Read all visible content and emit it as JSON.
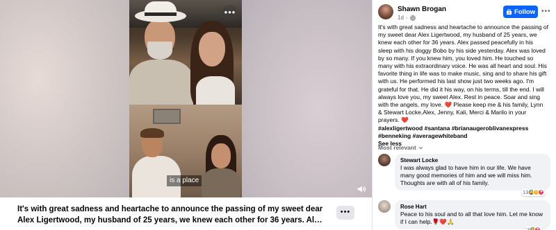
{
  "media": {
    "caption_overlay": "is a place",
    "more_label": "•••",
    "icons": {
      "sound": "speaker-icon",
      "more": "ellipsis-icon"
    }
  },
  "caption_bar": {
    "text": "It's with great sadness and heartache to announce the passing of my sweet dear Alex Ligertwood, my husband of 25 years, we knew each other for 36 years. Alex passed...",
    "more_label": "•••"
  },
  "post": {
    "author": "Shawn Brogan",
    "time": "1d",
    "privacy_separator": "·",
    "follow_label": "Follow",
    "more_label": "•••",
    "body_text": "It's with great sadness and heartache to announce the passing of my sweet dear Alex Ligertwood, my husband of 25 years, we knew each other for 36 years. Alex passed peacefully in his sleep with his doggy Bobo by his side yesterday. Alex was loved by so many. If you knew him, you loved him. He touched so many with his extraordinary voice. He was all heart and soul. His favorite thing in life was to make music, sing and to share his gift with us. He performed his last show just two weeks ago. I'm grateful for that. He did it his way, on his terms, till the end. I will always love you, my sweet Alex. Rest in peace. Soar and sing with the angels, my love.",
    "heart_1": "❤️",
    "body_text_2": " Please keep me & his family, Lynn & Stewart Locke,Alex, Jenny, Kali, Merci & Marilo in your prayers. ",
    "heart_2": "❤️",
    "hashtags": "#alexligertwood #santana #brianaugeroblivanexpress #benneking #averagewhiteband",
    "see_less": "See less",
    "brand_colors": {
      "follow_button": "#0866ff",
      "heart": "#e41e3f",
      "secondary_text": "#65676b",
      "bubble_bg": "#f0f2f5"
    }
  },
  "comments_filter": "Most relevant",
  "comments": [
    {
      "name": "Stewart Locke",
      "text": "I was always glad to have him in our life. We have many good memories of him and we will miss him. Thoughts are with all of his family.",
      "reaction_count": "13"
    },
    {
      "name": "Rose Hart",
      "text": "Peace to his soul and to all that love him. Let me know if I can help.",
      "emoji": "🌹❤️🙏",
      "reaction_count": "3"
    }
  ]
}
